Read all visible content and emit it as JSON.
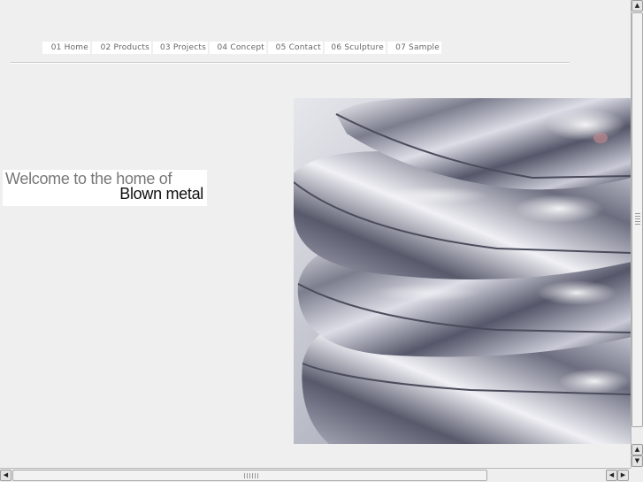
{
  "nav": {
    "items": [
      {
        "label": "01 Home"
      },
      {
        "label": "02 Products"
      },
      {
        "label": "03 Projects"
      },
      {
        "label": "04 Concept"
      },
      {
        "label": "05 Contact"
      },
      {
        "label": "06 Sculpture"
      },
      {
        "label": "07 Sample"
      }
    ]
  },
  "welcome": {
    "line1": "Welcome to the home of",
    "line2": "Blown metal"
  },
  "hero": {
    "image": "blown-metal-cushions-stack"
  },
  "scrollbars": {
    "up_icon": "arrow-up-icon",
    "down_icon": "arrow-down-icon",
    "left_icon": "arrow-left-icon",
    "right_icon": "arrow-right-icon"
  }
}
